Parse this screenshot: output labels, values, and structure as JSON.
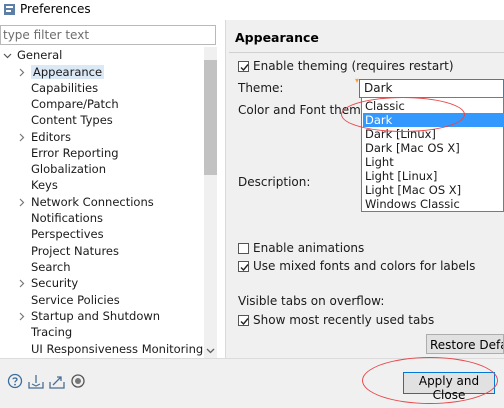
{
  "window": {
    "title": "Preferences",
    "icon": "eclipse-prefs-icon"
  },
  "filter": {
    "placeholder": "type filter text"
  },
  "tree": {
    "root": "General",
    "items": [
      "Appearance",
      "Capabilities",
      "Compare/Patch",
      "Content Types",
      "Editors",
      "Error Reporting",
      "Globalization",
      "Keys",
      "Network Connections",
      "Notifications",
      "Perspectives",
      "Project Natures",
      "Search",
      "Security",
      "Service Policies",
      "Startup and Shutdown",
      "Tracing",
      "UI Responsiveness Monitoring"
    ],
    "selected": "Appearance"
  },
  "page": {
    "title": "Appearance",
    "enable_theming": {
      "label": "Enable theming (requires restart)",
      "checked": true
    },
    "theme_label": "Theme:",
    "theme_value": "Dark",
    "theme_options": [
      "Classic",
      "Dark",
      "Dark [Linux]",
      "Dark [Mac OS X]",
      "Light",
      "Light [Linux]",
      "Light [Mac OS X]",
      "Windows Classic"
    ],
    "color_font_label": "Color and Font theme:",
    "description_label": "Description:",
    "enable_animations": {
      "label": "Enable animations",
      "checked": false
    },
    "mixed_fonts": {
      "label": "Use mixed fonts and colors for labels",
      "checked": true
    },
    "visible_tabs_label": "Visible tabs on overflow:",
    "show_recent": {
      "label": "Show most recently used tabs",
      "checked": true
    },
    "restore_label": "Restore Defaults"
  },
  "bottom": {
    "icons": [
      "help-icon",
      "import-icon",
      "export-icon",
      "preferences-record-icon"
    ],
    "apply_close_label": "Apply and Close"
  },
  "colors": {
    "selection": "#3399ff",
    "annotation": "#e8474a",
    "panel": "#f0f0f0"
  }
}
